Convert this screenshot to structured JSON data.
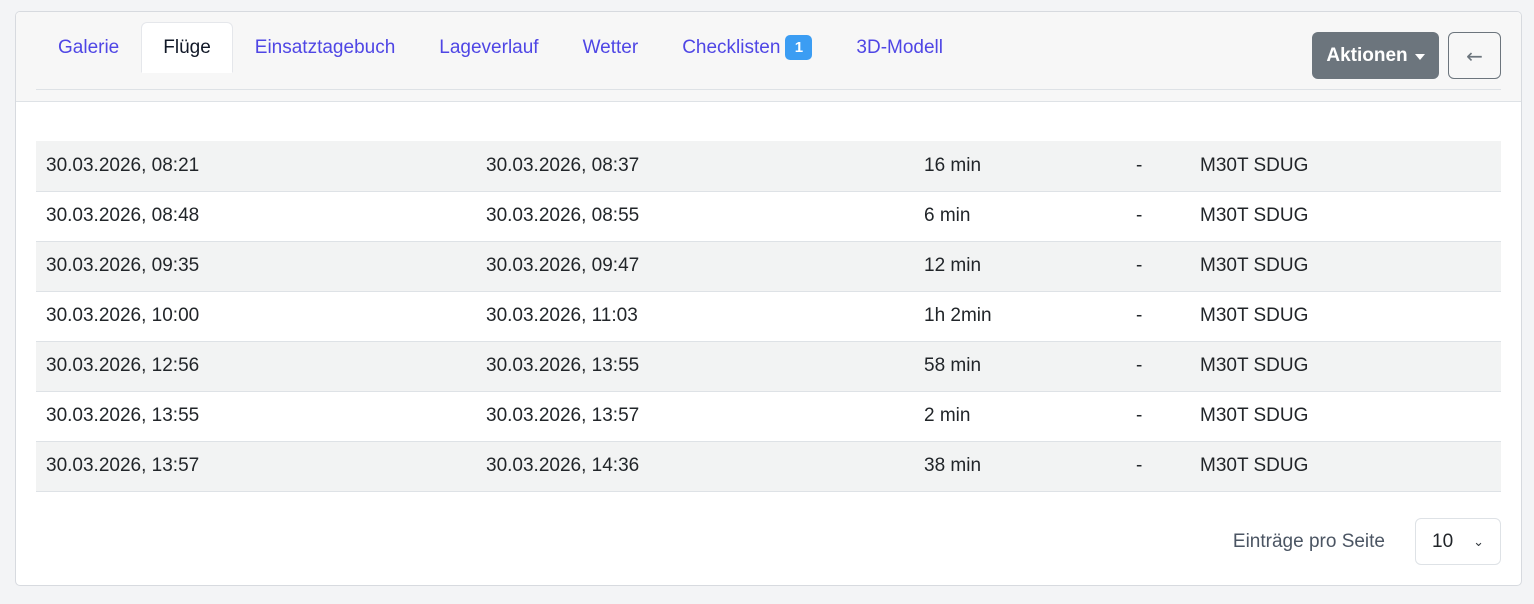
{
  "tabs": [
    {
      "label": "Galerie",
      "active": false
    },
    {
      "label": "Flüge",
      "active": true
    },
    {
      "label": "Einsatztagebuch",
      "active": false
    },
    {
      "label": "Lageverlauf",
      "active": false
    },
    {
      "label": "Wetter",
      "active": false
    },
    {
      "label": "Checklisten",
      "active": false,
      "badge": "1"
    },
    {
      "label": "3D-Modell",
      "active": false
    }
  ],
  "header": {
    "actions_label": "Aktionen",
    "back_icon": "←"
  },
  "table": {
    "rows": [
      {
        "start": "30.03.2026, 08:21",
        "end": "30.03.2026, 08:37",
        "duration": "16 min",
        "pilot": "-",
        "drone": "M30T SDUG"
      },
      {
        "start": "30.03.2026, 08:48",
        "end": "30.03.2026, 08:55",
        "duration": "6 min",
        "pilot": "-",
        "drone": "M30T SDUG"
      },
      {
        "start": "30.03.2026, 09:35",
        "end": "30.03.2026, 09:47",
        "duration": "12 min",
        "pilot": "-",
        "drone": "M30T SDUG"
      },
      {
        "start": "30.03.2026, 10:00",
        "end": "30.03.2026, 11:03",
        "duration": "1h 2min",
        "pilot": "-",
        "drone": "M30T SDUG"
      },
      {
        "start": "30.03.2026, 12:56",
        "end": "30.03.2026, 13:55",
        "duration": "58 min",
        "pilot": "-",
        "drone": "M30T SDUG"
      },
      {
        "start": "30.03.2026, 13:55",
        "end": "30.03.2026, 13:57",
        "duration": "2 min",
        "pilot": "-",
        "drone": "M30T SDUG"
      },
      {
        "start": "30.03.2026, 13:57",
        "end": "30.03.2026, 14:36",
        "duration": "38 min",
        "pilot": "-",
        "drone": "M30T SDUG"
      }
    ]
  },
  "pagination": {
    "label": "Einträge pro Seite",
    "page_size": "10",
    "chevron_icon": "⌄"
  },
  "colors": {
    "tab_link": "#4f46e5",
    "badge": "#3b9df3",
    "actions_button": "#6c757d",
    "striped_row": "#f2f3f3"
  }
}
